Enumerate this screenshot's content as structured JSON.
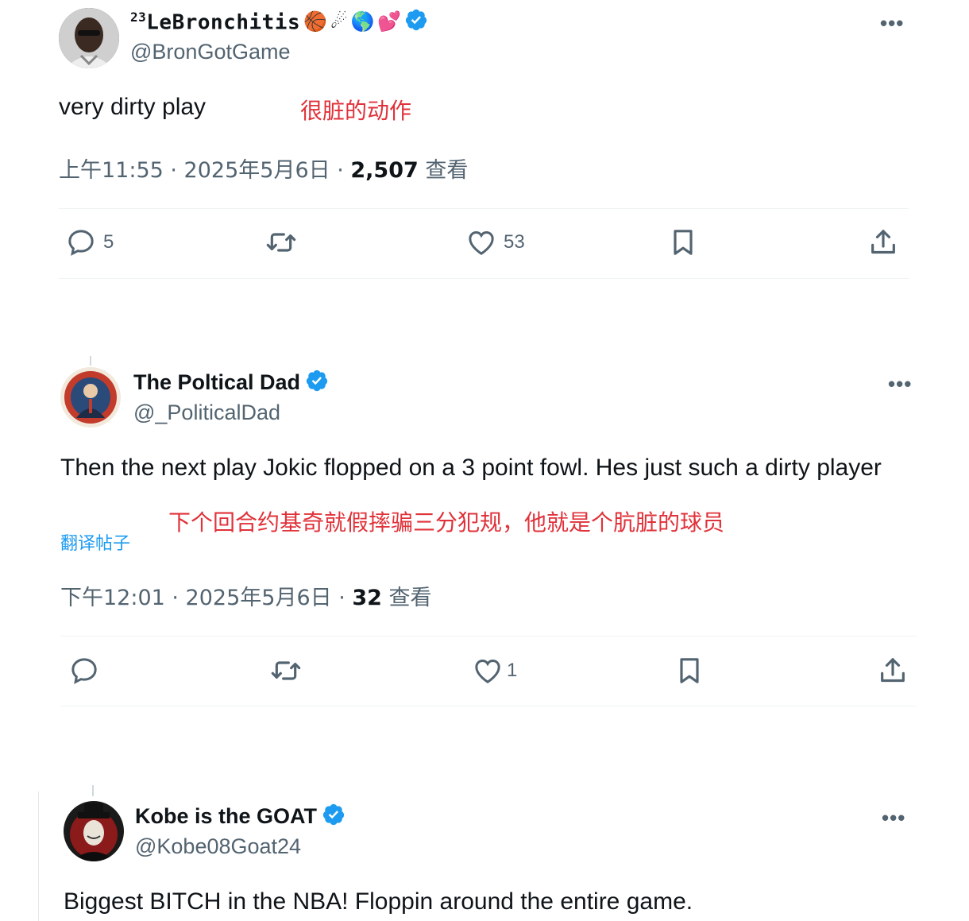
{
  "tweets": [
    {
      "prefix": "23",
      "name": "LeBronchitis",
      "handle": "@BronGotGame",
      "text": "very dirty play",
      "translation": "很脏的动作",
      "time": "上午11:55 · 2025年5月6日 · ",
      "views": "2,507",
      "views_label": " 查看",
      "replies": "5",
      "retweets": "",
      "likes": "53"
    },
    {
      "name": "The Poltical Dad",
      "handle": "@_PoliticalDad",
      "text": "Then the next play Jokic flopped on a 3 point fowl. Hes just such a dirty player",
      "translation": "下个回合约基奇就假摔骗三分犯规，他就是个肮脏的球员",
      "translate_link": "翻译帖子",
      "time": "下午12:01 · 2025年5月6日 · ",
      "views": "32",
      "views_label": " 查看",
      "replies": "",
      "retweets": "",
      "likes": "1"
    },
    {
      "name": "Kobe is the GOAT",
      "handle": "@Kobe08Goat24",
      "text": "Biggest BITCH in the NBA! Floppin around the entire game."
    }
  ],
  "more_label": "•••",
  "colors": {
    "verified": "#1d9bf0",
    "annotation": "#e0323a"
  }
}
